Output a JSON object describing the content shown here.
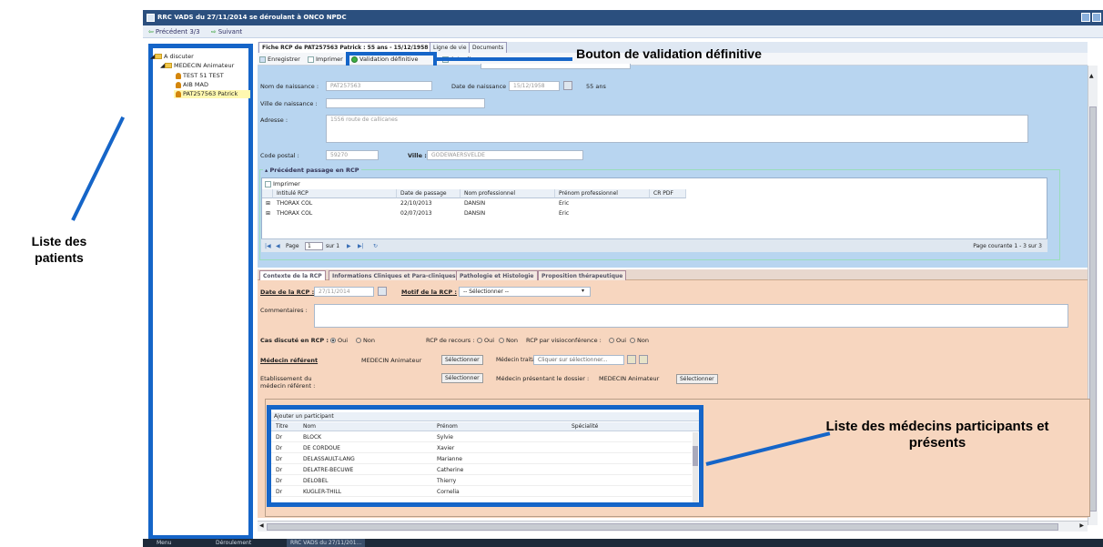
{
  "window": {
    "title": "RRC VADS du 27/11/2014 se déroulant à ONCO NPDC"
  },
  "nav": {
    "prev": "Précédent 3/3",
    "next": "Suivant"
  },
  "tree": {
    "root": "A discuter",
    "group": "MEDECIN Animateur",
    "patients": [
      "TEST 51 TEST",
      "AIB MAD",
      "PAT257563 Patrick"
    ]
  },
  "fiche": {
    "tabs": [
      "Fiche RCP de PAT257563 Patrick : 55 ans - 15/12/1958",
      "Ligne de vie",
      "Documents"
    ],
    "toolbar": {
      "save": "Enregistrer",
      "print": "Imprimer",
      "validate": "Validation définitive",
      "refresh": "Actualiser"
    },
    "birth_name_label": "Nom de naissance :",
    "birth_name": "PAT257563",
    "birth_date_label": "Date de naissance :",
    "birth_date": "15/12/1958",
    "age": "55 ans",
    "birth_city_label": "Ville de naissance :",
    "address_label": "Adresse :",
    "address": "1556 route de callicanes",
    "postal_label": "Code postal :",
    "postal": "59270",
    "city_label": "Ville :",
    "city": "GODEWAERSVELDE"
  },
  "previous_rcp": {
    "title": "Précédent passage en RCP",
    "print": "Imprimer",
    "columns": [
      "Intitulé RCP",
      "Date de passage",
      "Nom professionnel",
      "Prénom professionnel",
      "CR PDF"
    ],
    "rows": [
      [
        "THORAX COL",
        "22/10/2013",
        "DANSIN",
        "Eric",
        ""
      ],
      [
        "THORAX COL",
        "02/07/2013",
        "DANSIN",
        "Eric",
        ""
      ]
    ],
    "pager": {
      "page": "Page",
      "page_value": "1",
      "of": "sur 1",
      "info": "Page courante 1 - 3 sur 3"
    }
  },
  "rcp_tabs": [
    "Contexte de la RCP",
    "Informations Cliniques et Para-cliniques",
    "Pathologie et Histologie",
    "Proposition thérapeutique"
  ],
  "contexte": {
    "date_label": "Date de la RCP",
    "date": "27/11/2014",
    "motif_label": "Motif de la RCP",
    "motif": "-- Sélectionner --",
    "comments_label": "Commentaires :",
    "cas_label": "Cas discuté en RCP :",
    "oui": "Oui",
    "non": "Non",
    "recours_label": "RCP de recours :",
    "visio_label": "RCP par visioconférence :",
    "medecin_ref_label": "Médecin référent",
    "medecin_ref": "MEDECIN Animateur",
    "select": "Sélectionner",
    "traitant_label": "Médecin traitant :",
    "traitant_placeholder": "Cliquer sur sélectionner...",
    "etab_label": "Etablissement du médecin référent :",
    "presentant_label": "Médecin présentant le dossier :",
    "presentant": "MEDECIN Animateur"
  },
  "participants": {
    "add": "Ajouter un participant",
    "columns": [
      "Titre",
      "Nom",
      "Prénom",
      "Spécialité"
    ],
    "rows": [
      [
        "Dr",
        "BLOCK",
        "Sylvie",
        ""
      ],
      [
        "Dr",
        "DE CORDOUE",
        "Xavier",
        ""
      ],
      [
        "Dr",
        "DELASSAULT-LANG",
        "Marianne",
        ""
      ],
      [
        "Dr",
        "DELATRE-BECUWE",
        "Catherine",
        ""
      ],
      [
        "Dr",
        "DELOBEL",
        "Thierry",
        ""
      ],
      [
        "Dr",
        "KUGLER-THILL",
        "Cornelia",
        ""
      ]
    ]
  },
  "taskbar": {
    "items": [
      "Menu",
      "Déroulement",
      "RRC VADS du 27/11/201..."
    ]
  },
  "annotations": {
    "patients": "Liste des patients",
    "validation": "Bouton de validation définitive",
    "medecins": "Liste des médecins participants et présents"
  },
  "colors": {
    "annotation_blue": "#1565c8",
    "patient_header": "#b8d5f0",
    "rcp_panel": "#f7d6bf"
  }
}
